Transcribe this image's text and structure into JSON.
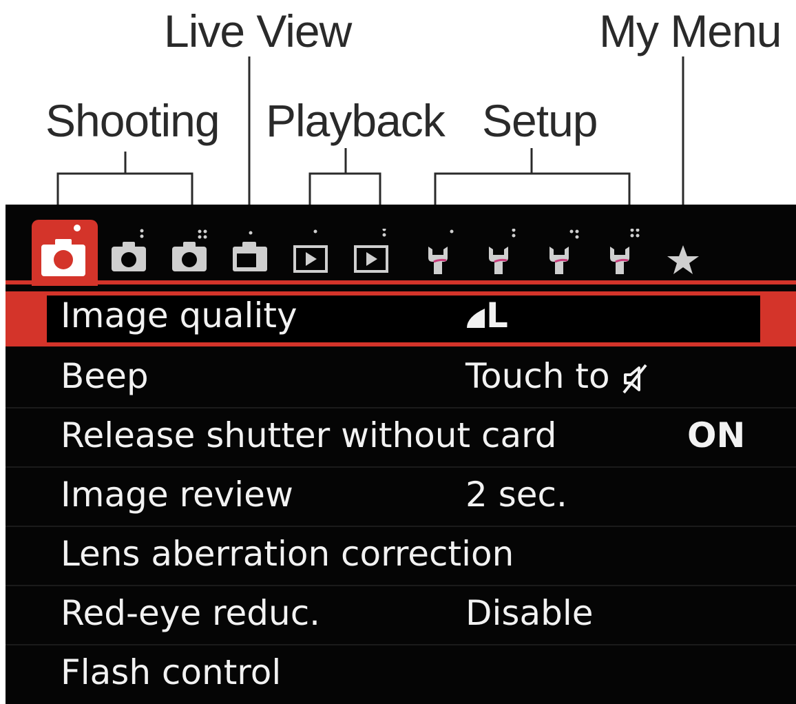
{
  "callouts": {
    "live_view": "Live View",
    "my_menu": "My Menu",
    "shooting": "Shooting",
    "playback": "Playback",
    "setup": "Setup"
  },
  "tabs": [
    {
      "icon": "camera-icon",
      "group": "Shooting",
      "dots": 1,
      "active": true
    },
    {
      "icon": "camera-icon",
      "group": "Shooting",
      "dots": 2,
      "active": false
    },
    {
      "icon": "camera-icon",
      "group": "Shooting",
      "dots": 4,
      "active": false
    },
    {
      "icon": "live-view-icon",
      "group": "Live View",
      "dots": 1,
      "active": false
    },
    {
      "icon": "playback-icon",
      "group": "Playback",
      "dots": 1,
      "active": false
    },
    {
      "icon": "playback-icon",
      "group": "Playback",
      "dots": 2,
      "active": false
    },
    {
      "icon": "wrench-icon",
      "group": "Setup",
      "dots": 1,
      "active": false
    },
    {
      "icon": "wrench-icon",
      "group": "Setup",
      "dots": 2,
      "active": false
    },
    {
      "icon": "wrench-icon",
      "group": "Setup",
      "dots": 3,
      "active": false
    },
    {
      "icon": "wrench-icon",
      "group": "Setup",
      "dots": 4,
      "active": false
    },
    {
      "icon": "star-icon",
      "group": "My Menu",
      "dots": 0,
      "active": false
    }
  ],
  "menu": {
    "items": [
      {
        "label": "Image quality",
        "value": "L",
        "value_icon": "quality-fine-icon",
        "selected": true
      },
      {
        "label": "Beep",
        "value": "Touch to",
        "value_icon": "mute-icon",
        "selected": false
      },
      {
        "label": "Release shutter without card",
        "value": "ON",
        "selected": false
      },
      {
        "label": "Image review",
        "value": "2 sec.",
        "selected": false
      },
      {
        "label": "Lens aberration correction",
        "value": "",
        "selected": false
      },
      {
        "label": "Red-eye reduc.",
        "value": "Disable",
        "selected": false
      },
      {
        "label": "Flash control",
        "value": "",
        "selected": false
      }
    ]
  },
  "colors": {
    "accent": "#d4342a",
    "screen_bg": "#050505",
    "text": "#f2f2f2",
    "callout_text": "#2a2a2a",
    "inactive_icon": "#cfcfcf"
  }
}
